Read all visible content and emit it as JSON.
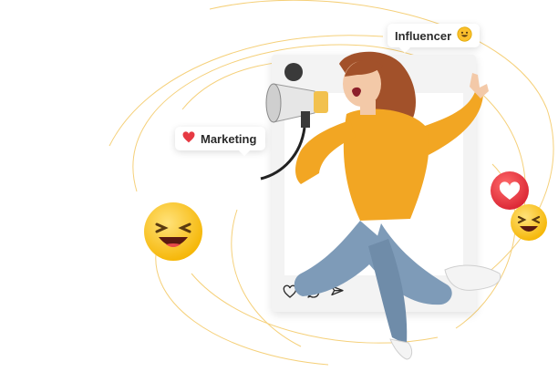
{
  "tags": {
    "influencer": {
      "label": "Influencer",
      "icon": "grinning-face-icon"
    },
    "marketing": {
      "label": "Marketing",
      "icon": "heart-icon"
    }
  },
  "post": {
    "actions": [
      "heart-outline-icon",
      "comment-icon",
      "send-icon"
    ]
  },
  "decorations": [
    "laughing-emoji-large",
    "heart-reaction-bubble",
    "laughing-emoji-small",
    "megaphone"
  ],
  "colors": {
    "accent_gold": "#f2c14e",
    "sweater": "#f2a623",
    "jeans": "#7e9bb8",
    "hair": "#a2512a",
    "heart_red": "#e63a43",
    "emoji_yellow": "#fbc02d"
  }
}
